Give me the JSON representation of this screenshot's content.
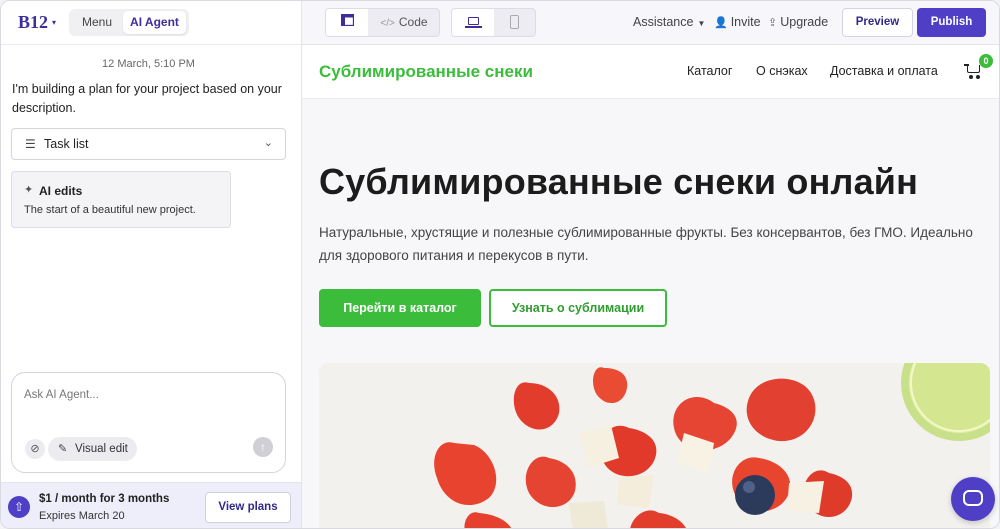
{
  "app": {
    "logo": "B12",
    "logo_caret": "▾",
    "tabs": {
      "menu": "Menu",
      "agent": "AI Agent"
    }
  },
  "chat": {
    "date": "12 March, 5:10 PM",
    "message": "I'm building a plan for your project based on your description.",
    "task_list_label": "Task list",
    "ai_edits_title": "AI edits",
    "ai_edits_desc": "The start of a beautiful new project.",
    "input_placeholder": "Ask AI Agent...",
    "visual_edit_label": "Visual edit"
  },
  "promo": {
    "title": "$1 / month for 3 months",
    "subtitle": "Expires March 20",
    "button": "View plans"
  },
  "toolbar": {
    "code_label": "Code",
    "assistance": "Assistance",
    "invite": "Invite",
    "upgrade": "Upgrade",
    "preview": "Preview",
    "publish": "Publish"
  },
  "site": {
    "logo": "Сублимированные снеки",
    "nav": [
      "Каталог",
      "О снэках",
      "Доставка и оплата"
    ],
    "cart_count": "0",
    "hero_title": "Сублимированные снеки онлайн",
    "hero_desc": "Натуральные, хрустящие и полезные сублимированные фрукты. Без консервантов, без ГМО. Идеально для здорового питания и перекусов в пути.",
    "cta_primary": "Перейти в каталог",
    "cta_secondary": "Узнать о сублимации"
  },
  "colors": {
    "brand_purple": "#4f3fc7",
    "site_green": "#3bbd3b"
  }
}
